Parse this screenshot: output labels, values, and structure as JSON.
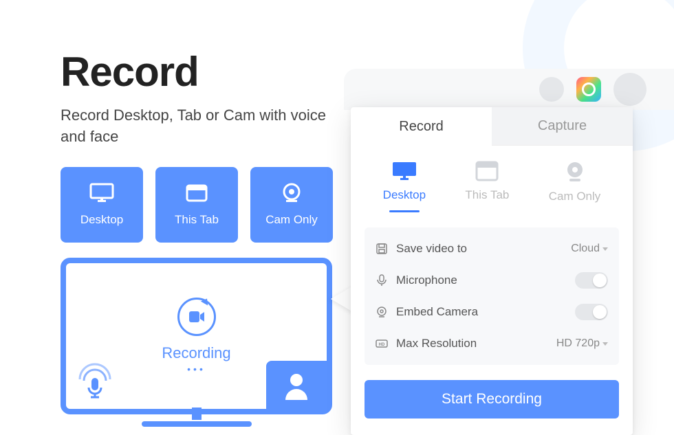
{
  "hero": {
    "title": "Record",
    "subtitle": "Record Desktop, Tab or Cam with voice and face"
  },
  "modes": {
    "desktop": "Desktop",
    "thisTab": "This Tab",
    "camOnly": "Cam Only"
  },
  "preview": {
    "status": "Recording",
    "dots": "•••"
  },
  "popup": {
    "tabs": {
      "record": "Record",
      "capture": "Capture"
    },
    "sources": {
      "desktop": "Desktop",
      "thisTab": "This Tab",
      "camOnly": "Cam Only"
    },
    "settings": {
      "saveTo": {
        "label": "Save video to",
        "value": "Cloud"
      },
      "microphone": {
        "label": "Microphone"
      },
      "embedCamera": {
        "label": "Embed Camera"
      },
      "maxRes": {
        "label": "Max Resolution",
        "value": "HD 720p"
      }
    },
    "startButton": "Start Recording"
  },
  "colors": {
    "accent": "#5a92ff"
  }
}
